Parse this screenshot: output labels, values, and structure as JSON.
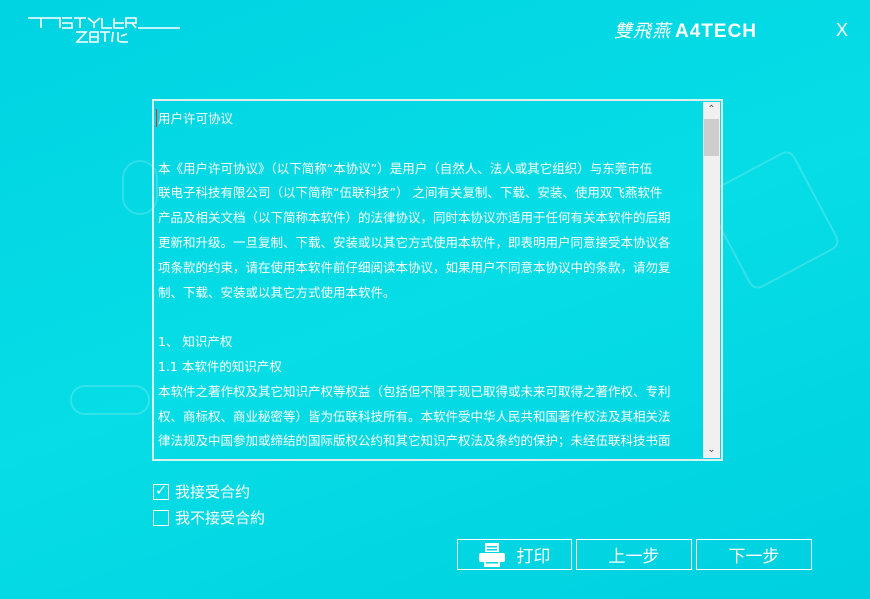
{
  "header": {
    "logo_text": "FSTYLER 飞时代",
    "brand_cn": "雙飛燕",
    "brand_en": "A4TECH",
    "close_label": "X"
  },
  "agreement": {
    "lines": [
      "用户许可协议",
      "",
      "本《用户许可协议》（以下简称“本协议”）是用户（自然人、法人或其它组织）与东莞市伍",
      "联电子科技有限公司（以下简称“伍联科技”） 之间有关复制、下载、安装、使用双飞燕软件",
      "产品及相关文档（以下简称本软件）的法律协议，同时本协议亦适用于任何有关本软件的后期",
      "更新和升级。一旦复制、下载、安装或以其它方式使用本软件，即表明用户同意接受本协议各",
      "项条款的约束，请在使用本软件前仔细阅读本协议，如果用户不同意本协议中的条款，请勿复",
      "制、下载、安装或以其它方式使用本软件。",
      "",
      "1、  知识产权",
      "1.1 本软件的知识产权",
      "本软件之著作权及其它知识产权等权益（包括但不限于现已取得或未来可取得之著作权、专利",
      "权、商标权、商业秘密等）皆为伍联科技所有。本软件受中华人民共和国著作权法及其相关法",
      "律法规及中国参加或缔结的国际版权公约和其它知识产权法及条约的保护；未经伍联科技书面"
    ]
  },
  "options": {
    "accept": {
      "label": "我接受合约",
      "checked": true
    },
    "decline": {
      "label": "我不接受合約",
      "checked": false
    }
  },
  "buttons": {
    "print": "打印",
    "prev": "上一步",
    "next": "下一步"
  }
}
